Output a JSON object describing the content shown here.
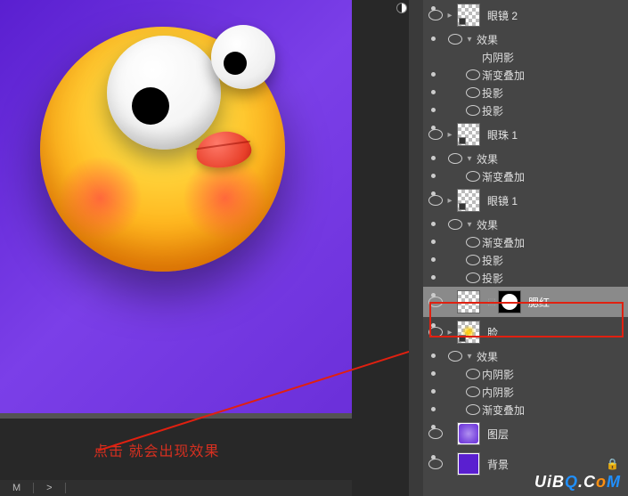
{
  "annotation_text": "点击  就会出现效果",
  "watermark": {
    "prefix": "UiB",
    "q": "Q",
    "c": ".C",
    "o": "o",
    "m": "M"
  },
  "bottom_tabs": [
    "M",
    ">"
  ],
  "layers": [
    {
      "name": "眼镜 2",
      "effects_label": "效果",
      "fx": [
        "内阴影",
        "渐变叠加",
        "投影",
        "投影"
      ]
    },
    {
      "name": "眼珠 1",
      "effects_label": "效果",
      "fx": [
        "渐变叠加"
      ]
    },
    {
      "name": "眼镜 1",
      "effects_label": "效果",
      "fx": [
        "渐变叠加",
        "投影",
        "投影"
      ]
    },
    {
      "name": "腮红",
      "selected": true
    },
    {
      "name": "脸",
      "effects_label": "效果",
      "fx": [
        "内阴影",
        "内阴影",
        "渐变叠加"
      ]
    },
    {
      "name": "图层"
    },
    {
      "name": "背景",
      "locked": true
    }
  ]
}
